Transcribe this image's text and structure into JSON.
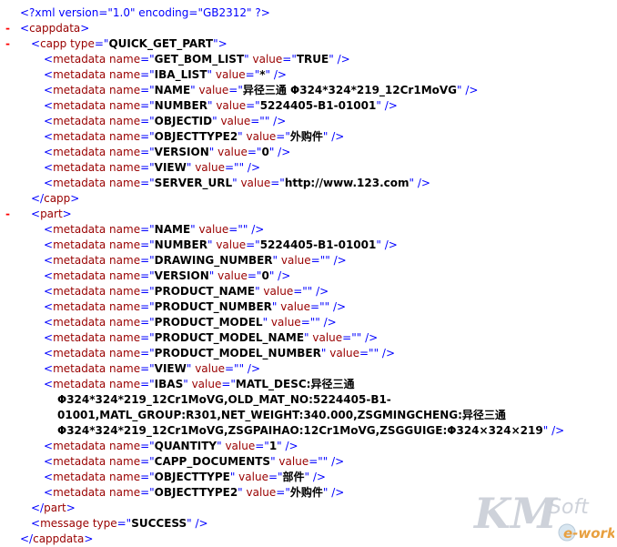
{
  "declaration": "<?xml version=\"1.0\" encoding=\"GB2312\" ?>",
  "toggle_glyph": "-",
  "root": {
    "tag": "cappdata"
  },
  "capp": {
    "tag": "capp",
    "attr_name": "type",
    "attr_value": "QUICK_GET_PART",
    "items": [
      {
        "name": "GET_BOM_LIST",
        "value": "TRUE"
      },
      {
        "name": "IBA_LIST",
        "value": "*"
      },
      {
        "name": "NAME",
        "value": "异径三通  Φ324*324*219_12Cr1MoVG"
      },
      {
        "name": "NUMBER",
        "value": "5224405-B1-01001"
      },
      {
        "name": "OBJECTID",
        "value": ""
      },
      {
        "name": "OBJECTTYPE2",
        "value": "外购件"
      },
      {
        "name": "VERSION",
        "value": "0"
      },
      {
        "name": "VIEW",
        "value": ""
      },
      {
        "name": "SERVER_URL",
        "value": "http://www.123.com"
      }
    ]
  },
  "part": {
    "tag": "part",
    "items_before": [
      {
        "name": "NAME",
        "value": ""
      },
      {
        "name": "NUMBER",
        "value": "5224405-B1-01001"
      },
      {
        "name": "DRAWING_NUMBER",
        "value": ""
      },
      {
        "name": "VERSION",
        "value": "0"
      },
      {
        "name": "PRODUCT_NAME",
        "value": ""
      },
      {
        "name": "PRODUCT_NUMBER",
        "value": ""
      },
      {
        "name": "PRODUCT_MODEL",
        "value": ""
      },
      {
        "name": "PRODUCT_MODEL_NAME",
        "value": ""
      },
      {
        "name": "PRODUCT_MODEL_NUMBER",
        "value": ""
      },
      {
        "name": "VIEW",
        "value": ""
      }
    ],
    "ibas": {
      "name": "IBAS",
      "value_lines": [
        "MATL_DESC:异径三通",
        "Φ324*324*219_12Cr1MoVG,OLD_MAT_NO:5224405-B1-",
        "01001,MATL_GROUP:R301,NET_WEIGHT:340.000,ZSGMINGCHENG:异径三通",
        "Φ324*324*219_12Cr1MoVG,ZSGPAIHAO:12Cr1MoVG,ZSGGUIGE:Φ324×324×219"
      ]
    },
    "items_after": [
      {
        "name": "QUANTITY",
        "value": "1"
      },
      {
        "name": "CAPP_DOCUMENTS",
        "value": ""
      },
      {
        "name": "OBJECTTYPE",
        "value": "部件"
      },
      {
        "name": "OBJECTTYPE2",
        "value": "外购件"
      }
    ]
  },
  "message": {
    "tag": "message",
    "attr_name": "type",
    "attr_value": "SUCCESS"
  },
  "watermark": {
    "brand_main": "KM",
    "brand_soft": "Soft",
    "brand_sub": "e-works"
  },
  "colors": {
    "tag": "#990000",
    "markup": "#0000ff",
    "toggle": "#ff0000",
    "value": "#000000"
  }
}
